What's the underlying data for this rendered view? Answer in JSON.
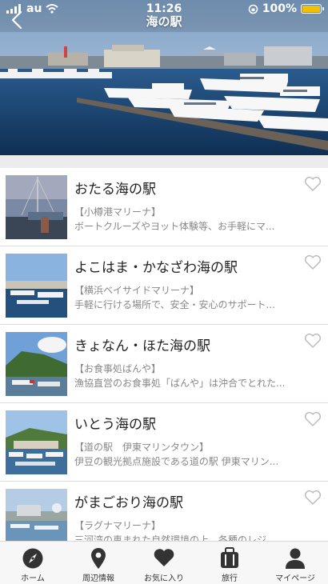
{
  "status_bar": {
    "carrier": "au",
    "time": "11:26",
    "battery": "100%",
    "battery_level": 1.0
  },
  "nav": {
    "title": "海の駅"
  },
  "stations": [
    {
      "title": "おたる海の駅",
      "subtitle": "【小樽港マリーナ】",
      "description": "ボートクルーズやヨット体験等、お手軽にマ..."
    },
    {
      "title": "よこはま・かなざわ海の駅",
      "subtitle": "【横浜ベイサイドマリーナ】",
      "description": "手軽に行ける場所で、安全・安心のサポート..."
    },
    {
      "title": "きょなん・ほた海の駅",
      "subtitle": "【お食事処ばんや】",
      "description": "漁協直営のお食事処「ばんや」は沖合でとれた..."
    },
    {
      "title": "いとう海の駅",
      "subtitle": "【道の駅　伊東マリンタウン】",
      "description": "伊豆の観光拠点施設である道の駅 伊東マリン..."
    },
    {
      "title": "がまごおり海の駅",
      "subtitle": "【ラグナマリーナ】",
      "description": "三河湾の恵まれた自然環境の上、各種のレジ..."
    }
  ],
  "tabs": [
    {
      "label": "ホーム",
      "icon": "compass-icon"
    },
    {
      "label": "周辺情報",
      "icon": "map-pin-icon"
    },
    {
      "label": "お気に入り",
      "icon": "heart-icon"
    },
    {
      "label": "旅行",
      "icon": "suitcase-icon"
    },
    {
      "label": "マイページ",
      "icon": "person-icon"
    }
  ],
  "colors": {
    "tab_icon": "#333333",
    "heart_outline": "#bbbbbb",
    "battery": "#f2c100"
  }
}
